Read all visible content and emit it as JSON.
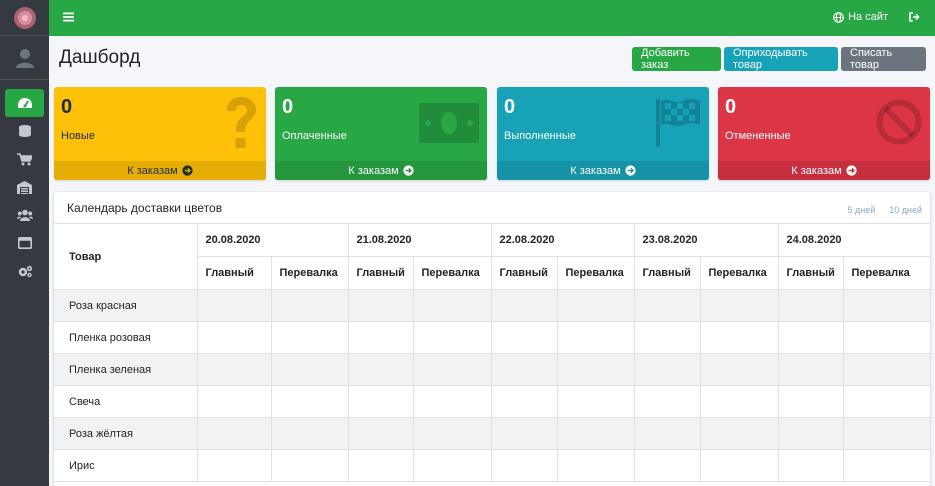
{
  "header": {
    "site_link": "На сайт",
    "icons": [
      "menu-icon",
      "globe-icon",
      "logout-icon"
    ]
  },
  "sidebar": {
    "items": [
      {
        "icon": "tachometer-icon",
        "active": true
      },
      {
        "icon": "coins-icon",
        "active": false
      },
      {
        "icon": "cart-icon",
        "active": false
      },
      {
        "icon": "warehouse-icon",
        "active": false
      },
      {
        "icon": "users-icon",
        "active": false
      },
      {
        "icon": "window-icon",
        "active": false
      },
      {
        "icon": "cogs-icon",
        "active": false
      }
    ]
  },
  "page": {
    "title": "Дашборд"
  },
  "toolbar": {
    "add_order": "Добавить заказ",
    "receive_goods": "Оприходывать товар",
    "write_off": "Списать товар"
  },
  "stats": [
    {
      "value": "0",
      "label": "Новые",
      "link": "К заказам",
      "color": "#ffc107",
      "icon": "question-icon"
    },
    {
      "value": "0",
      "label": "Оплаченные",
      "link": "К заказам",
      "color": "#28a745",
      "icon": "money-icon"
    },
    {
      "value": "0",
      "label": "Выполненные",
      "link": "К заказам",
      "color": "#17a2b8",
      "icon": "checkered-flag-icon"
    },
    {
      "value": "0",
      "label": "Отмененные",
      "link": "К заказам",
      "color": "#dc3545",
      "icon": "ban-icon"
    }
  ],
  "calendar": {
    "title": "Календарь доставки цветов",
    "range_5": "5 дней",
    "range_10": "10 дней",
    "product_header": "Товар",
    "dates": [
      "20.08.2020",
      "21.08.2020",
      "22.08.2020",
      "23.08.2020",
      "24.08.2020"
    ],
    "subcolumns": [
      "Главный",
      "Перевалка"
    ],
    "rows": [
      "Роза красная",
      "Пленка розовая",
      "Пленка зеленая",
      "Свеча",
      "Роза жёлтая",
      "Ирис"
    ]
  }
}
